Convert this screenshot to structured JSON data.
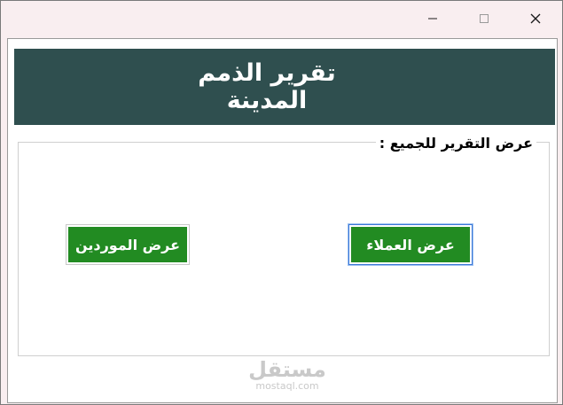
{
  "window": {
    "controls": {
      "minimize_icon": "minimize-icon",
      "maximize_icon": "maximize-icon",
      "close_icon": "close-icon"
    }
  },
  "header": {
    "title": "تقرير الذمم المدينة",
    "background": "#2f4f4f"
  },
  "group": {
    "legend": "عرض التقرير للجميع :",
    "buttons": {
      "customers_label": "عرض العملاء",
      "suppliers_label": "عرض الموردين"
    },
    "button_color": "#228b22"
  },
  "watermark": {
    "arabic": "مستقل",
    "latin": "mostaql.com"
  }
}
